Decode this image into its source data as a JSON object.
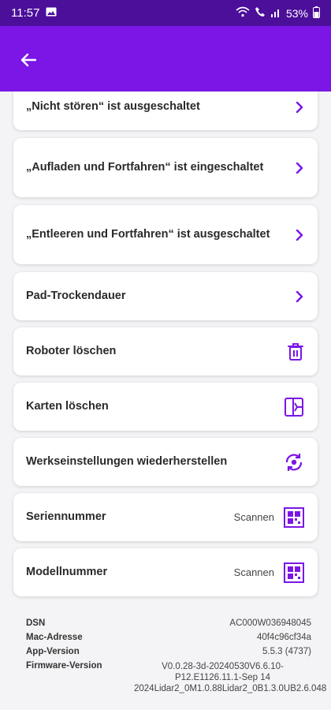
{
  "status_bar": {
    "time": "11:57",
    "battery": "53%"
  },
  "settings": [
    {
      "label": "„Nicht stören“ ist ausgeschaltet",
      "trail": "chevron"
    },
    {
      "label": "„Aufladen und Fortfahren“ ist eingeschaltet",
      "trail": "chevron"
    },
    {
      "label": "„Entleeren und Fortfahren“ ist ausgeschaltet",
      "trail": "chevron"
    },
    {
      "label": "Pad-Trockendauer",
      "trail": "chevron"
    },
    {
      "label": "Roboter löschen",
      "trail": "trash-icon"
    },
    {
      "label": "Karten löschen",
      "trail": "map-delete-icon"
    },
    {
      "label": "Werkseinstellungen wiederherstellen",
      "trail": "reset-icon"
    },
    {
      "label": "Seriennummer",
      "trail": "qr-icon",
      "action": "Scannen"
    },
    {
      "label": "Modellnummer",
      "trail": "qr-icon",
      "action": "Scannen"
    }
  ],
  "device_info": {
    "dsn_label": "DSN",
    "dsn_value": "AC000W036948045",
    "mac_label": "Mac-Adresse",
    "mac_value": "40f4c96cf34a",
    "app_label": "App-Version",
    "app_value": "5.5.3 (4737)",
    "fw_label": "Firmware-Version",
    "fw_value": "V0.0.28-3d-20240530V6.6.10-P12.E1126.11.1-Sep 14 2024Lidar2_0M1.0.88Lidar2_0B1.3.0UB2.6.048"
  },
  "colors": {
    "status_bar": "#4b0f9a",
    "app_bar": "#7b16e6",
    "accent": "#7b16e6"
  }
}
